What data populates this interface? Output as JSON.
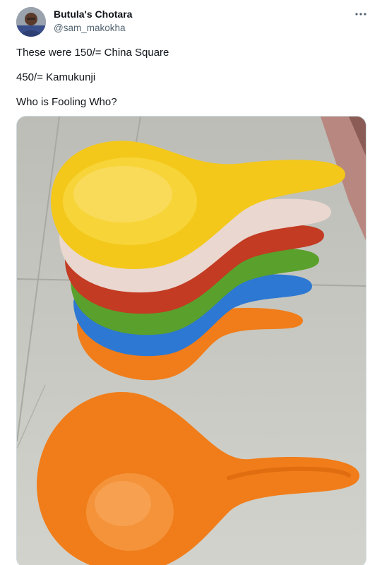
{
  "author": {
    "display_name": "Butula's Chotara",
    "handle": "@sam_makokha",
    "avatar_icon": "user-avatar"
  },
  "more_icon": "more-options-icon",
  "tweet": {
    "lines": [
      "These were 150/= China Square",
      "450/= Kamukunji",
      "Who is Fooling Who?"
    ]
  },
  "media": {
    "subject_icon": "stacked-plastic-scoops-photo",
    "colors": {
      "yellow": "#f3c81a",
      "white": "#ead7cf",
      "red": "#c23b22",
      "green": "#5aa02c",
      "blue": "#2d78d2",
      "orange": "#f07d1a",
      "floor": "#c9c9c3"
    }
  }
}
